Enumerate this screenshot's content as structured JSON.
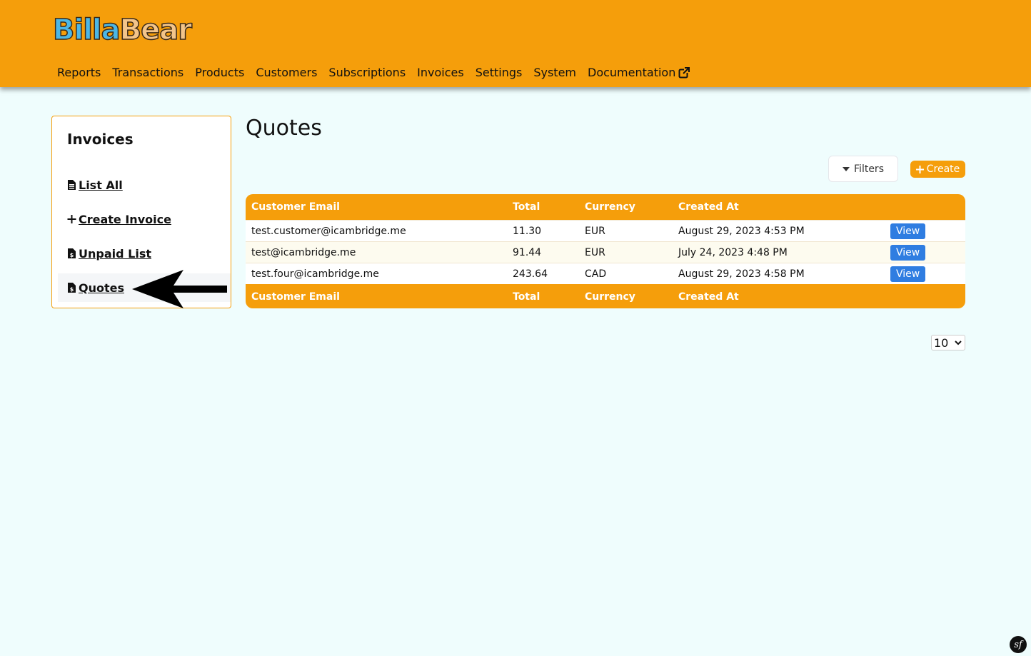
{
  "brand": {
    "name_part1": "Billa",
    "name_part2": "Bear"
  },
  "nav": {
    "items": [
      "Reports",
      "Transactions",
      "Products",
      "Customers",
      "Subscriptions",
      "Invoices",
      "Settings",
      "System",
      "Documentation"
    ]
  },
  "sidebar": {
    "title": "Invoices",
    "items": [
      {
        "label": "List All",
        "icon": "file-invoice-icon"
      },
      {
        "label": "Create Invoice",
        "icon": "plus-icon"
      },
      {
        "label": "Unpaid List",
        "icon": "file-invoice-dollar-icon"
      },
      {
        "label": "Quotes",
        "icon": "file-invoice-dollar-icon",
        "active": true
      }
    ]
  },
  "main": {
    "title": "Quotes",
    "filters_label": "Filters",
    "create_label": "Create",
    "table": {
      "columns": [
        "Customer Email",
        "Total",
        "Currency",
        "Created At",
        ""
      ],
      "rows": [
        {
          "email": "test.customer@icambridge.me",
          "total": "11.30",
          "currency": "EUR",
          "created_at": "August 29, 2023 4:53 PM",
          "action": "View"
        },
        {
          "email": "test@icambridge.me",
          "total": "91.44",
          "currency": "EUR",
          "created_at": "July 24, 2023 4:48 PM",
          "action": "View"
        },
        {
          "email": "test.four@icambridge.me",
          "total": "243.64",
          "currency": "CAD",
          "created_at": "August 29, 2023 4:58 PM",
          "action": "View"
        }
      ]
    },
    "page_size": "10"
  },
  "colors": {
    "accent": "#f59e0b",
    "background": "#effdfd",
    "view_button": "#2f7de1"
  },
  "debug_badge": "sf"
}
